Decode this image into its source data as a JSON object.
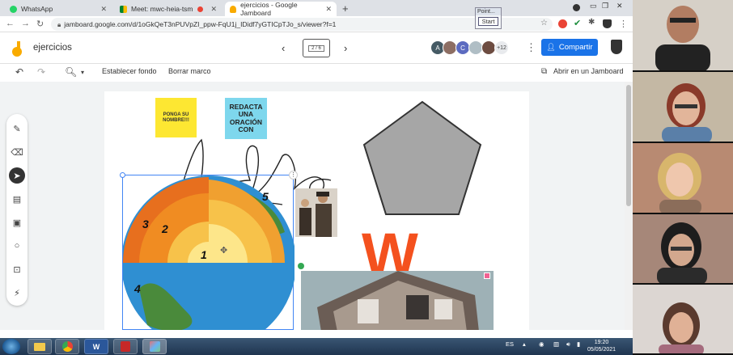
{
  "tabs": [
    {
      "title": "WhatsApp",
      "active": false
    },
    {
      "title": "Meet: mwc-heia-tsm",
      "active": false
    },
    {
      "title": "ejercicios - Google Jamboard",
      "active": true
    }
  ],
  "address": {
    "url": "jamboard.google.com/d/1oGkQeT3nPUVpZI_ppw-FqU1j_IDidf7yGTICpTJo_s/viewer?f=1"
  },
  "pointer_widget": {
    "title": "Point...",
    "button": "Start"
  },
  "jamboard": {
    "title": "ejercicios",
    "frame_indicator": "2 / 6",
    "collaborators": [
      {
        "initial": "A",
        "color": "#455a64"
      },
      {
        "initial": "",
        "color": "#8d6e63"
      },
      {
        "initial": "C",
        "color": "#5c6bc0"
      },
      {
        "initial": "",
        "color": "#b0bec5"
      },
      {
        "initial": "",
        "color": "#6d4c41"
      }
    ],
    "more_collaborators": "+12",
    "share_label": "Compartir"
  },
  "toolbar": {
    "set_background": "Establecer fondo",
    "clear_frame": "Borrar marco",
    "open_in_jamboard": "Abrir en un Jamboard"
  },
  "canvas": {
    "sticky_yellow": "PONGA SU NOMBRE!!!",
    "sticky_blue": "REDACTA UNA ORACIÓN CON",
    "earth_labels": [
      "1",
      "2",
      "3",
      "4",
      "5"
    ],
    "letter": "W"
  },
  "taskbar": {
    "lang": "ES",
    "time": "19:20",
    "date": "05/05/2021",
    "word_label": "W"
  },
  "colors": {
    "accent": "#1a73e8",
    "sticky_yellow": "#fde732",
    "sticky_blue": "#7ed7ed",
    "w_letter": "#f4511e"
  }
}
